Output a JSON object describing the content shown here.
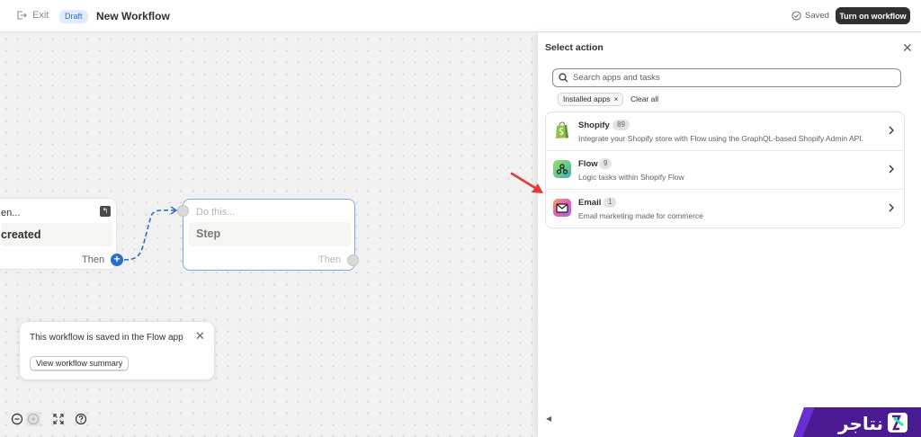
{
  "topbar": {
    "exit_label": "Exit",
    "draft_badge": "Draft",
    "title": "New Workflow",
    "saved_label": "Saved",
    "turn_on_label": "Turn on workflow"
  },
  "canvas": {
    "trigger_node": {
      "header": "en...",
      "body": "created",
      "then_label": "Then"
    },
    "action_node": {
      "header": "Do this...",
      "body": "Step",
      "then_label": "Then"
    },
    "notice": {
      "message": "This workflow is saved in the Flow app",
      "button_label": "View workflow summary"
    }
  },
  "panel": {
    "title": "Select action",
    "search_placeholder": "Search apps and tasks",
    "filter_chip": "Installed apps",
    "clear_all": "Clear all",
    "items": [
      {
        "name": "Shopify",
        "count": "89",
        "description": "Integrate your Shopify store with Flow using the GraphQL-based Shopify Admin API.",
        "icon": "shopify-bag-icon"
      },
      {
        "name": "Flow",
        "count": "9",
        "description": "Logic tasks within Shopify Flow",
        "icon": "flow-icon"
      },
      {
        "name": "Email",
        "count": "1",
        "description": "Email marketing made for commerce",
        "icon": "email-icon"
      }
    ]
  },
  "brand": {
    "logo_text": "نتاجر"
  },
  "colors": {
    "accent_blue": "#2c6ecb",
    "dark_button": "#303030",
    "annotation_arrow": "#e53935",
    "logo_bg": "#4a1a93"
  }
}
